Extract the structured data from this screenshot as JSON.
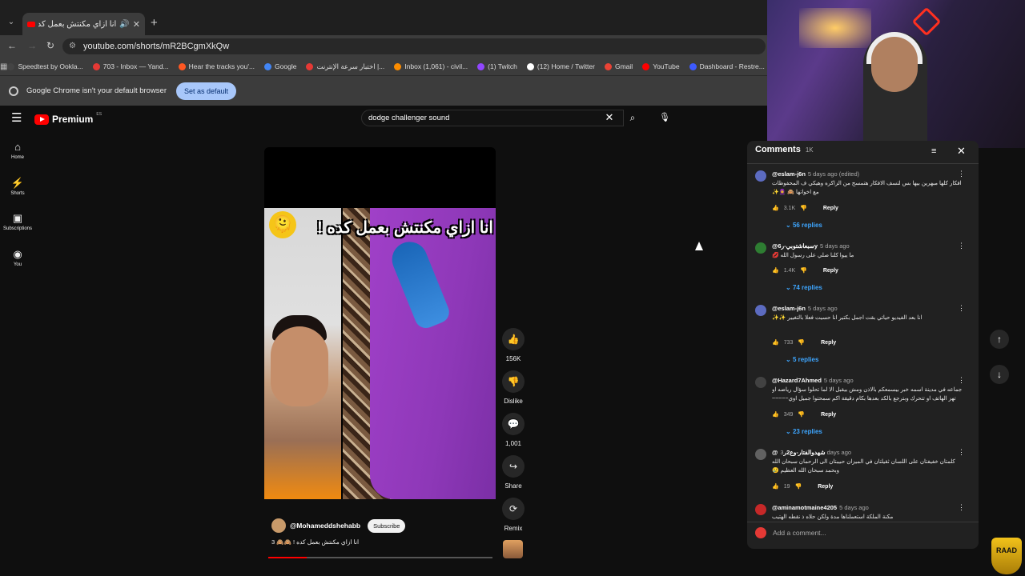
{
  "browser": {
    "tab_title": "انا ازاي مكنتش بعمل كده ! 🙈",
    "url": "youtube.com/shorts/mR2BCgmXkQw",
    "bookmarks": [
      {
        "label": "Speedtest by Ookla...",
        "color": "#444444"
      },
      {
        "label": "703 - Inbox — Yand...",
        "color": "#e53935"
      },
      {
        "label": "Hear the tracks you'...",
        "color": "#ff5722"
      },
      {
        "label": "Google",
        "color": "#4285f4"
      },
      {
        "label": "اختبار سرعة الإنترنت |...",
        "color": "#e53935"
      },
      {
        "label": "Inbox (1,061) - civil...",
        "color": "#fb8c00"
      },
      {
        "label": "(1) Twitch",
        "color": "#9146ff"
      },
      {
        "label": "(12) Home / Twitter",
        "color": "#ffffff"
      },
      {
        "label": "Gmail",
        "color": "#ea4335"
      },
      {
        "label": "YouTube",
        "color": "#ff0000"
      },
      {
        "label": "Dashboard - Restre...",
        "color": "#3d5afe"
      }
    ],
    "infobar_text": "Google Chrome isn't your default browser",
    "set_default_label": "Set as default"
  },
  "youtube": {
    "logo_text": "Premium",
    "logo_region": "ES",
    "search_value": "dodge challenger sound",
    "sidebar": [
      {
        "label": "Home",
        "icon": "⌂"
      },
      {
        "label": "Shorts",
        "icon": "⚡"
      },
      {
        "label": "Subscriptions",
        "icon": "▣"
      },
      {
        "label": "You",
        "icon": "◉"
      }
    ]
  },
  "short": {
    "overlay_title": "انا ازاي مكنتش بعمل كده !",
    "overlay_emoji": "🫠",
    "channel": "@Mohameddshehabb",
    "subscribe_label": "Subscribe",
    "caption": "انا ازاي مكنتش بعمل كده ! 🙈🙈 3",
    "progress": 0.17,
    "actions": [
      {
        "icon": "👍",
        "label": "156K"
      },
      {
        "icon": "👎",
        "label": "Dislike"
      },
      {
        "icon": "💬",
        "label": "1,001"
      },
      {
        "icon": "↪",
        "label": "Share"
      },
      {
        "icon": "⟳",
        "label": "Remix"
      }
    ]
  },
  "comments": {
    "title": "Comments",
    "count": "1K",
    "add_placeholder": "Add a comment...",
    "reply_label": "Reply",
    "items": [
      {
        "author": "@eslam-j6n",
        "date": "5 days ago (edited)",
        "text": "افكار كلها مبهرين بيها بس لتسف الافكار هتمسح من الزاكره وهيكي ف المحفوظات مع اخواتها 🙈 🧕✨",
        "likes": "3.1K",
        "replies": "56 replies",
        "avatar": "#5c6bc0"
      },
      {
        "author": "@سبعاشتوبي-ر6y",
        "date": "5 days ago",
        "text": "ما ييوا كلنا صلي على رسول الله 💋",
        "likes": "1.4K",
        "replies": "74 replies",
        "avatar": "#2e7d32"
      },
      {
        "author": "@eslam-j6n",
        "date": "5 days ago",
        "text": "انا بعد الفيديو حياتي بقت اجمل بكتير انا حسيت فعلا بالتغيير ✨✨",
        "likes": "733",
        "replies": "5 replies",
        "avatar": "#5c6bc0"
      },
      {
        "author": "@Hazard7Ahmed",
        "date": "5 days ago",
        "text": "جماعه في مدينة اسمه خبر بيسمعكم بالاذن ومش بيقبل الا لما تحلوا سؤال رياضه او تهز الهاتف او تتحرك وبترجع بالكد بعدها بكام دقيقة اكم سمحتوا جميل اوي~~~~~",
        "likes": "349",
        "replies": "23 replies",
        "avatar": "#424242"
      },
      {
        "author": "@شهدوالفتار-وع2ر",
        "date": "3 days ago",
        "text": "كلمتان خفيفتان على اللسان ثقيلتان في الميزان حبيبتان الى الرحمان سبحان الله وبحمد سبحان الله العظيم 😢",
        "likes": "19",
        "replies": "",
        "avatar": "#616161"
      },
      {
        "author": "@aminamotmaine4205",
        "date": "5 days ago",
        "text": "مكنة الملكة استعملناها مدة ولكن حلاه ذ نقطه الهتيب",
        "likes": "",
        "replies": "",
        "avatar": "#c62828"
      }
    ]
  },
  "stream_badge": "RAAD"
}
